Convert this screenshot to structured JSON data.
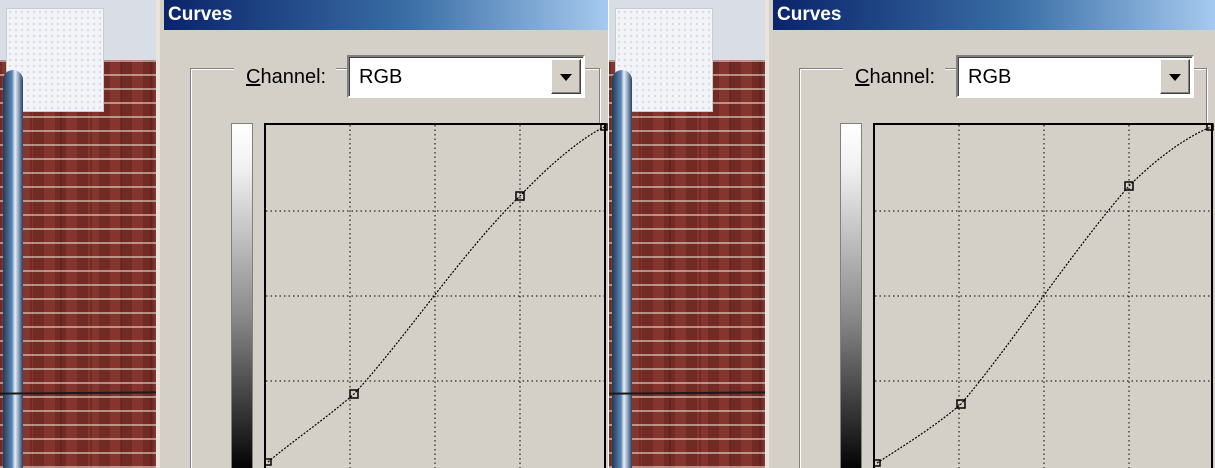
{
  "panels": [
    {
      "dialog_title": "Curves",
      "channel_label_mnemonic": "C",
      "channel_label_rest": "hannel:",
      "channel_value": "RGB",
      "curve": {
        "shape": "s-curve",
        "control_points": [
          [
            0,
            0
          ],
          [
            64,
            52
          ],
          [
            192,
            200
          ],
          [
            255,
            255
          ]
        ]
      }
    },
    {
      "dialog_title": "Curves",
      "channel_label_mnemonic": "C",
      "channel_label_rest": "hannel:",
      "channel_value": "RGB",
      "curve": {
        "shape": "s-curve",
        "control_points": [
          [
            0,
            0
          ],
          [
            64,
            47
          ],
          [
            192,
            210
          ],
          [
            255,
            255
          ]
        ]
      }
    }
  ],
  "icons": {
    "dropdown": "chevron-down-icon",
    "point": "curve-point-icon"
  },
  "colors": {
    "dialog_bg": "#d4d0c8",
    "title_start": "#0a246a",
    "title_end": "#a6caf0"
  }
}
